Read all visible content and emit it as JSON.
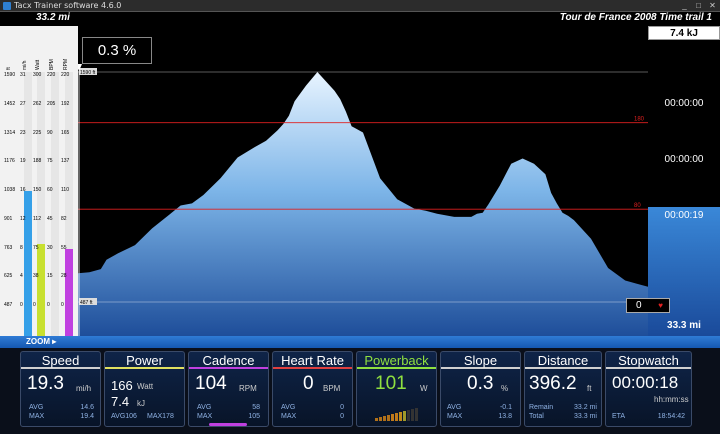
{
  "window": {
    "title": "Tacx Trainer software 4.6.0",
    "min": "_",
    "max": "□",
    "close": "✕"
  },
  "top": {
    "distance": "33.2  mi",
    "course": "Tour de France 2008 Time trail 1"
  },
  "slope_box": "0.3 %",
  "left_scale": {
    "headers": [
      "ft",
      "mi/h",
      "Watt",
      "BPM",
      "RPM"
    ],
    "rows": [
      [
        "1590",
        "31",
        "300",
        "220",
        "220"
      ],
      [
        "1452",
        "27",
        "262",
        "205",
        "192"
      ],
      [
        "1314",
        "23",
        "225",
        "90",
        "165"
      ],
      [
        "1176",
        "19",
        "188",
        "75",
        "137"
      ],
      [
        "1038",
        "16",
        "150",
        "60",
        "110"
      ],
      [
        "901",
        "12",
        "112",
        "45",
        "82"
      ],
      [
        "763",
        "8",
        "75",
        "30",
        "55"
      ],
      [
        "625",
        "4",
        "38",
        "15",
        "28"
      ],
      [
        "487",
        "0",
        "0",
        "0",
        "0"
      ]
    ],
    "levels": [
      0.62,
      0.55,
      0.35,
      0.0,
      0.33
    ]
  },
  "right": {
    "energy": "7.4 kJ",
    "times": [
      "00:00:00",
      "00:00:00",
      "00:00:19"
    ],
    "total_distance": "33.3 mi",
    "hr_value": "0",
    "heart_icon": "heart-icon"
  },
  "chart_data": {
    "type": "area",
    "x": [
      0,
      0.02,
      0.04,
      0.05,
      0.07,
      0.1,
      0.13,
      0.16,
      0.18,
      0.2,
      0.22,
      0.25,
      0.28,
      0.31,
      0.33,
      0.35,
      0.36,
      0.37,
      0.38,
      0.4,
      0.42,
      0.44,
      0.45,
      0.46,
      0.47,
      0.48,
      0.5,
      0.53,
      0.56,
      0.59,
      0.61,
      0.63,
      0.66,
      0.68,
      0.69,
      0.7,
      0.71,
      0.72,
      0.73,
      0.74,
      0.76,
      0.78,
      0.8,
      0.82,
      0.83,
      0.84,
      0.85,
      0.86,
      0.87,
      0.9,
      0.93,
      0.96,
      1.0
    ],
    "y": [
      625,
      630,
      645,
      690,
      720,
      760,
      840,
      905,
      950,
      960,
      1000,
      1080,
      1180,
      1230,
      1260,
      1310,
      1340,
      1380,
      1450,
      1525,
      1590,
      1530,
      1500,
      1460,
      1400,
      1330,
      1300,
      1080,
      980,
      935,
      925,
      910,
      895,
      895,
      895,
      910,
      915,
      955,
      1000,
      1045,
      1150,
      1175,
      1150,
      1100,
      1010,
      960,
      915,
      900,
      880,
      790,
      650,
      590,
      560
    ],
    "ylim": [
      487,
      1590
    ],
    "top_label": "1590 ft",
    "bottom_label": "487 ft",
    "hr_lines": [
      {
        "label": "180",
        "value": 1347
      },
      {
        "label": "80",
        "value": 932
      }
    ],
    "area_color": "#5d9fe0"
  },
  "zoom": {
    "label": "ZOOM"
  },
  "dashboard": {
    "speed": {
      "title": "Speed",
      "value": "19.3",
      "unit": "mi/h",
      "avg_label": "AVG",
      "avg": "14.6",
      "max_label": "MAX",
      "max": "19.4"
    },
    "power": {
      "title": "Power",
      "value": "166",
      "unit": "Watt",
      "energy": "7.4",
      "energy_unit": "kJ",
      "avg": "AVG106",
      "max": "MAX178"
    },
    "cadence": {
      "title": "Cadence",
      "value": "104",
      "unit": "RPM",
      "avg_label": "AVG",
      "avg": "58",
      "max_label": "MAX",
      "max": "105"
    },
    "heartrate": {
      "title": "Heart Rate",
      "value": "0",
      "unit": "BPM",
      "avg_label": "AVG",
      "avg": "0",
      "max_label": "MAX",
      "max": "0"
    },
    "powerback": {
      "title": "Powerback",
      "value": "101",
      "unit": "W"
    },
    "slope": {
      "title": "Slope",
      "value": "0.3",
      "unit": "%",
      "avg_label": "AVG",
      "avg": "-0.1",
      "max_label": "MAX",
      "max": "13.8"
    },
    "distance": {
      "title": "Distance",
      "value": "396.2",
      "unit": "ft",
      "remain_label": "Remain",
      "remain": "33.2 mi",
      "total_label": "Total",
      "total": "33.3 mi"
    },
    "stopwatch": {
      "title": "Stopwatch",
      "value": "00:00:18",
      "unit": "hh:mm:ss",
      "eta_label": "ETA",
      "eta": "18:54:42"
    }
  }
}
